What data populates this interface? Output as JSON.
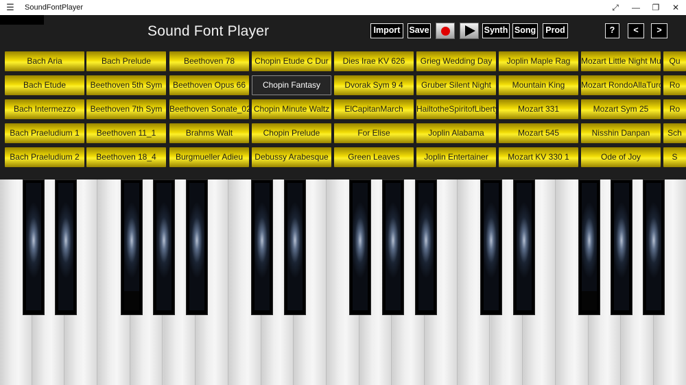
{
  "window": {
    "title": "SoundFontPlayer",
    "menu_icon": "hamburger-icon",
    "buttons": [
      "fullscreen-icon",
      "minimize-icon",
      "maximize-icon",
      "close-icon"
    ]
  },
  "header": {
    "title": "Sound Font Player"
  },
  "toolbar": {
    "import_label": "Import",
    "save_label": "Save",
    "record_icon": "record-icon",
    "play_icon": "play-icon",
    "synth_label": "Synth",
    "song_label": "Song",
    "prod_label": "Prod",
    "help_label": "?",
    "prev_label": "<",
    "next_label": ">"
  },
  "colors": {
    "song_button_gold": "#f1dc06",
    "record_red": "#e00000",
    "background": "#1e1e1e"
  },
  "songs": {
    "selected": "Chopin Fantasy",
    "col0": [
      "Bach Aria",
      "Bach Etude",
      "Bach Intermezzo",
      "Bach Praeludium 1",
      "Bach Praeludium 2"
    ],
    "col1": [
      "Bach Prelude",
      "Beethoven 5th Sym",
      "Beethoven 7th Sym",
      "Beethoven 11_1",
      "Beethoven 18_4"
    ],
    "col2": [
      "Beethoven 78",
      "Beethoven Opus 66",
      "Beethoven Sonate_02",
      "Brahms Walt",
      "Burgmueller Adieu"
    ],
    "col3": [
      "Chopin Etude C Dur",
      "Chopin Fantasy",
      "Chopin Minute Waltz",
      "Chopin Prelude",
      "Debussy Arabesque"
    ],
    "col4": [
      "Dies Irae KV 626",
      "Dvorak Sym 9 4",
      "ElCapitanMarch",
      "For Elise",
      "Green Leaves"
    ],
    "col5": [
      "Grieg Wedding Day",
      "Gruber Silent Night",
      "HailtotheSpiritofLiberty",
      "Joplin Alabama",
      "Joplin Entertainer"
    ],
    "col6": [
      "Joplin Maple Rag",
      "Mountain King",
      "Mozart 331",
      "Mozart 545",
      "Mozart KV 330 1"
    ],
    "col7": [
      "Mozart Little Night Music",
      "Mozart RondoAllaTurca",
      "Mozart Sym 25",
      "Nisshin Danpan",
      "Ode of Joy"
    ],
    "col8": [
      "Qu",
      "Ro",
      "Ro",
      "Sch",
      "S"
    ]
  }
}
